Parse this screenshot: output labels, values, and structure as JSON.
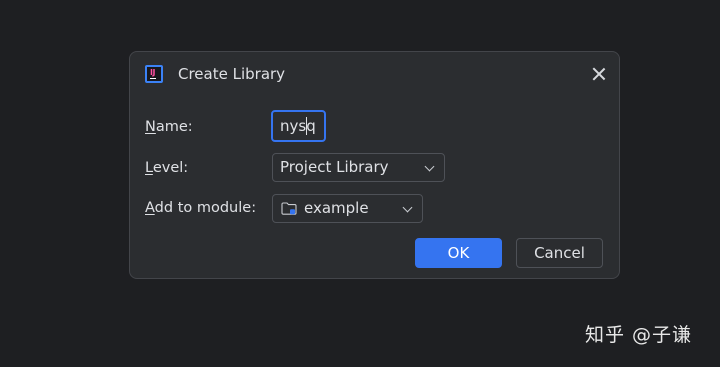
{
  "dialog": {
    "title": "Create Library",
    "icon": "intellij-idea-icon",
    "close_icon": "close-icon"
  },
  "form": {
    "name": {
      "label_mnemonic": "N",
      "label_rest": "ame:",
      "value": "nysq"
    },
    "level": {
      "label_mnemonic": "L",
      "label_rest": "evel:",
      "selected": "Project Library"
    },
    "module": {
      "label_mnemonic": "A",
      "label_rest": "dd to module:",
      "selected": "example",
      "icon": "module-folder-icon"
    }
  },
  "buttons": {
    "ok": "OK",
    "cancel": "Cancel"
  },
  "watermark": "知乎 @子谦",
  "colors": {
    "background": "#1e1f22",
    "dialog": "#2b2d30",
    "accent": "#3574f0",
    "text": "#dfe1e5"
  }
}
